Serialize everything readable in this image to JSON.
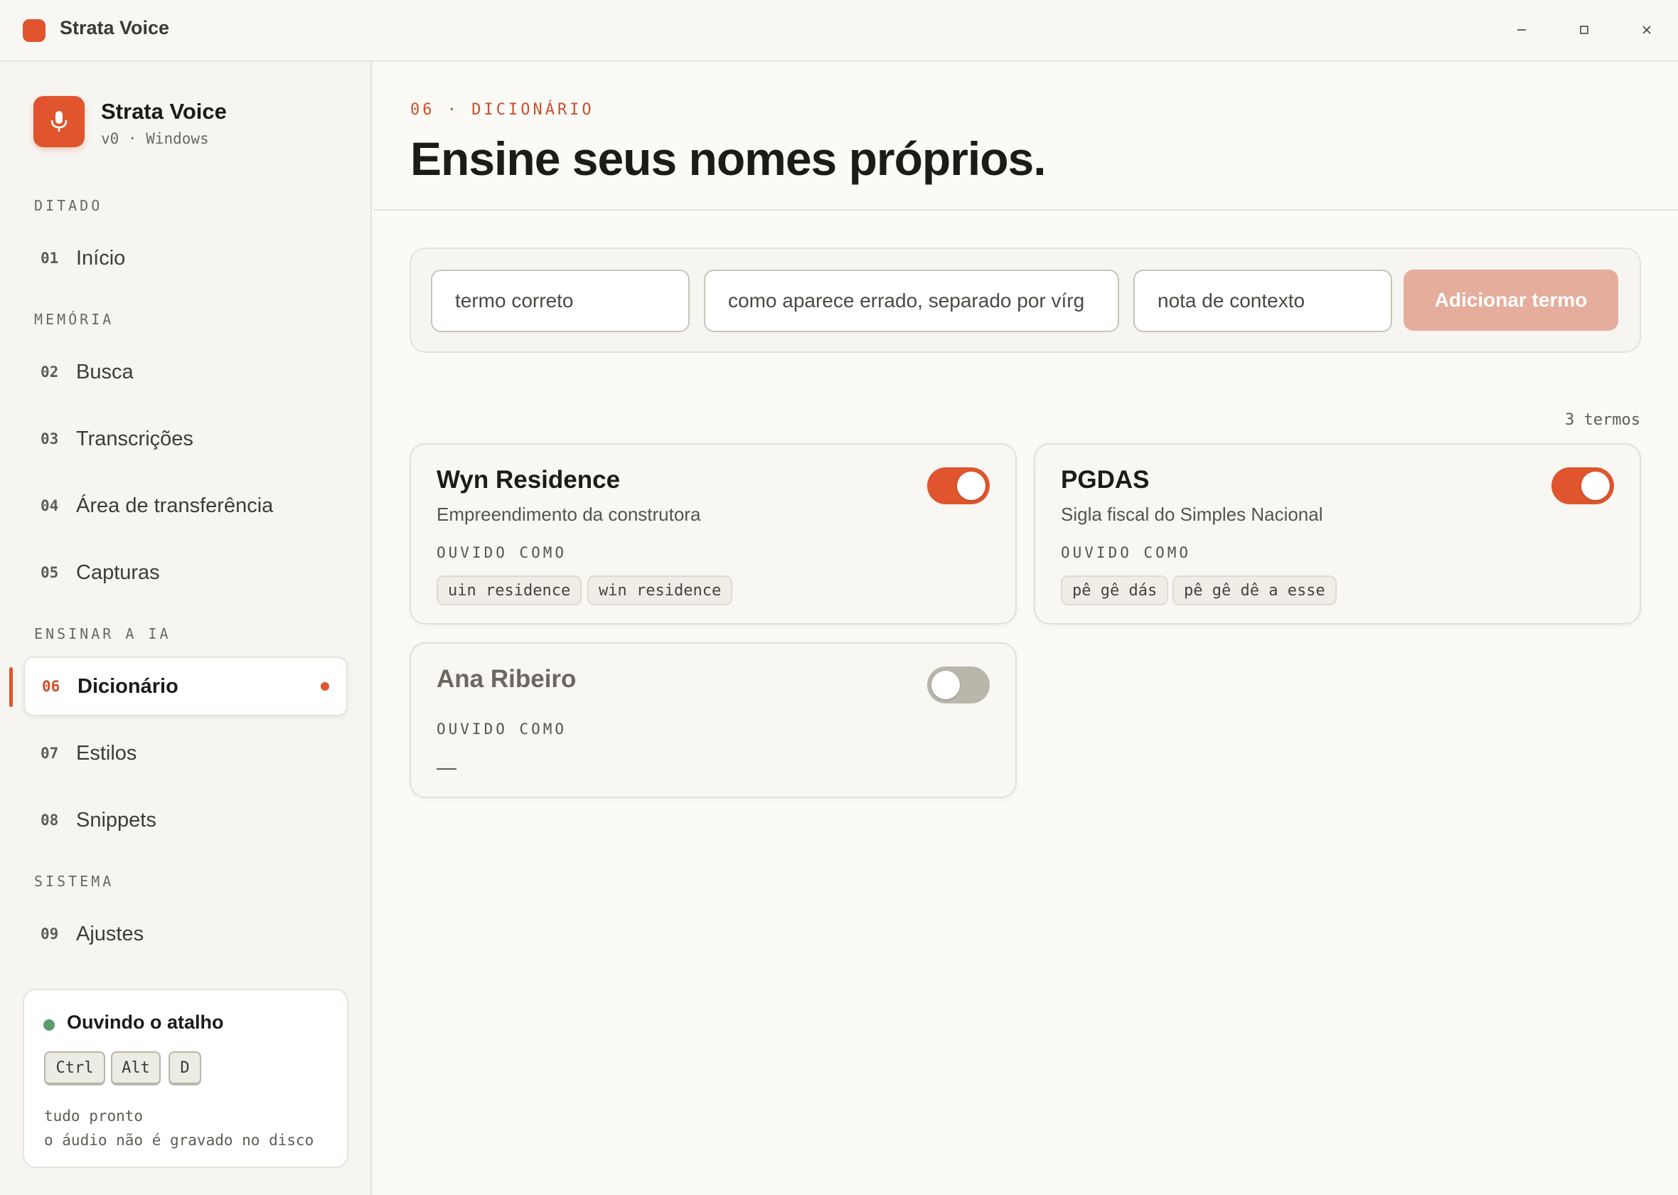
{
  "window": {
    "title": "Strata Voice",
    "accent": "#e0552d"
  },
  "sidebar": {
    "brand_name": "Strata Voice",
    "brand_sub": "v0 · Windows",
    "brand_icon": "microphone-icon",
    "sections": {
      "ditado": "DITADO",
      "memoria": "MEMÓRIA",
      "ensinar": "ENSINAR A IA",
      "sistema": "SISTEMA"
    },
    "items": [
      {
        "num": "01",
        "label": "Início"
      },
      {
        "num": "02",
        "label": "Busca"
      },
      {
        "num": "03",
        "label": "Transcrições"
      },
      {
        "num": "04",
        "label": "Área de transferência"
      },
      {
        "num": "05",
        "label": "Capturas"
      },
      {
        "num": "06",
        "label": "Dicionário"
      },
      {
        "num": "07",
        "label": "Estilos"
      },
      {
        "num": "08",
        "label": "Snippets"
      },
      {
        "num": "09",
        "label": "Ajustes"
      }
    ],
    "status": {
      "title": "Ouvindo o atalho",
      "keys": [
        "Ctrl",
        "Alt",
        "D"
      ],
      "line1": "tudo pronto",
      "line2": "o áudio não é gravado no disco"
    }
  },
  "main": {
    "eyebrow": "06 · DICIONÁRIO",
    "title": "Ensine seus nomes próprios.",
    "form": {
      "term_placeholder": "termo correto",
      "misheard_placeholder": "como aparece errado, separado por vírg",
      "note_placeholder": "nota de contexto",
      "add_label": "Adicionar termo"
    },
    "count": "3 termos",
    "heard_label": "OUVIDO COMO",
    "terms": [
      {
        "name": "Wyn Residence",
        "note": "Empreendimento da construtora",
        "heard": [
          "uin residence",
          "win residence"
        ],
        "enabled": true
      },
      {
        "name": "PGDAS",
        "note": "Sigla fiscal do Simples Nacional",
        "heard": [
          "pê gê dás",
          "pê gê dê a esse"
        ],
        "enabled": true
      },
      {
        "name": "Ana Ribeiro",
        "note": "",
        "heard_empty": "—",
        "enabled": false
      }
    ]
  }
}
